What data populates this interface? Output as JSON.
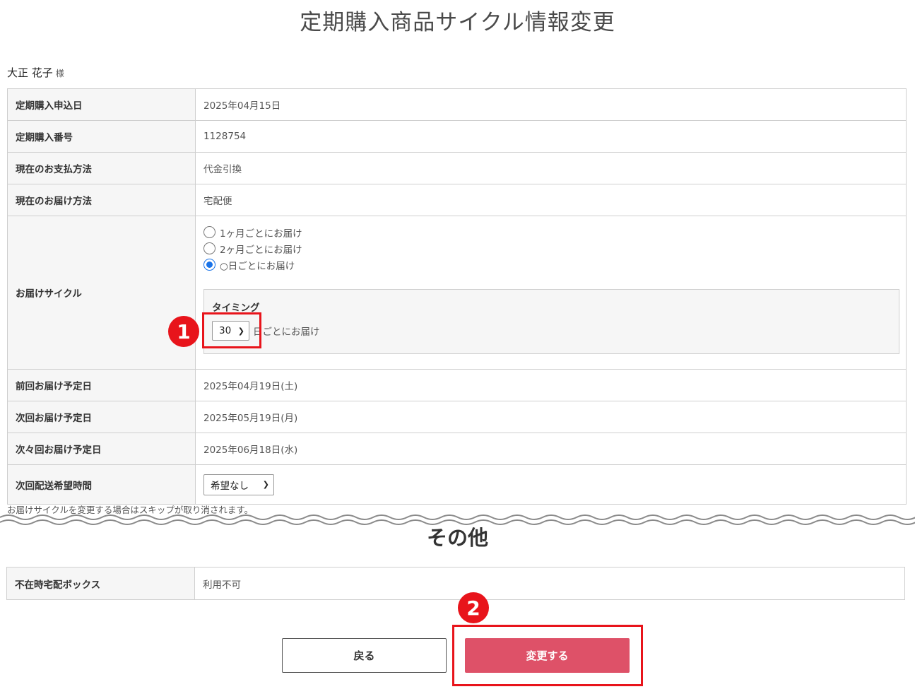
{
  "page_title": "定期購入商品サイクル情報変更",
  "customer": {
    "name": "大正 花子",
    "honorific": "様"
  },
  "rows": {
    "application_date": {
      "label": "定期購入申込日",
      "value": "2025年04月15日"
    },
    "subscription_number": {
      "label": "定期購入番号",
      "value": "1128754"
    },
    "payment_method": {
      "label": "現在のお支払方法",
      "value": "代金引換"
    },
    "delivery_method": {
      "label": "現在のお届け方法",
      "value": "宅配便"
    },
    "cycle": {
      "label": "お届けサイクル",
      "options": [
        {
          "label": "1ヶ月ごとにお届け",
          "checked": false
        },
        {
          "label": "2ヶ月ごとにお届け",
          "checked": false
        },
        {
          "label": "○日ごとにお届け",
          "checked": true
        }
      ],
      "timing_title": "タイミング",
      "timing_value": "30",
      "timing_suffix": "日ごとにお届け"
    },
    "previous_delivery": {
      "label": "前回お届け予定日",
      "value": "2025年04月19日(土)"
    },
    "next_delivery": {
      "label": "次回お届け予定日",
      "value": "2025年05月19日(月)"
    },
    "after_next_delivery": {
      "label": "次々回お届け予定日",
      "value": "2025年06月18日(水)"
    },
    "delivery_time": {
      "label": "次回配送希望時間",
      "value": "希望なし"
    }
  },
  "note": "お届けサイクルを変更する場合はスキップが取り消されます。",
  "other": {
    "title": "その他",
    "delivery_box": {
      "label": "不在時宅配ボックス",
      "value": "利用不可"
    }
  },
  "buttons": {
    "back": "戻る",
    "change": "変更する"
  },
  "annotations": {
    "badge1": "1",
    "badge2": "2"
  },
  "colors": {
    "accent": "#de5168",
    "highlight": "#e8141b",
    "radio": "#1a73e8"
  },
  "icons": {
    "select": "chevron-down-icon",
    "radio": "radio-icon"
  }
}
